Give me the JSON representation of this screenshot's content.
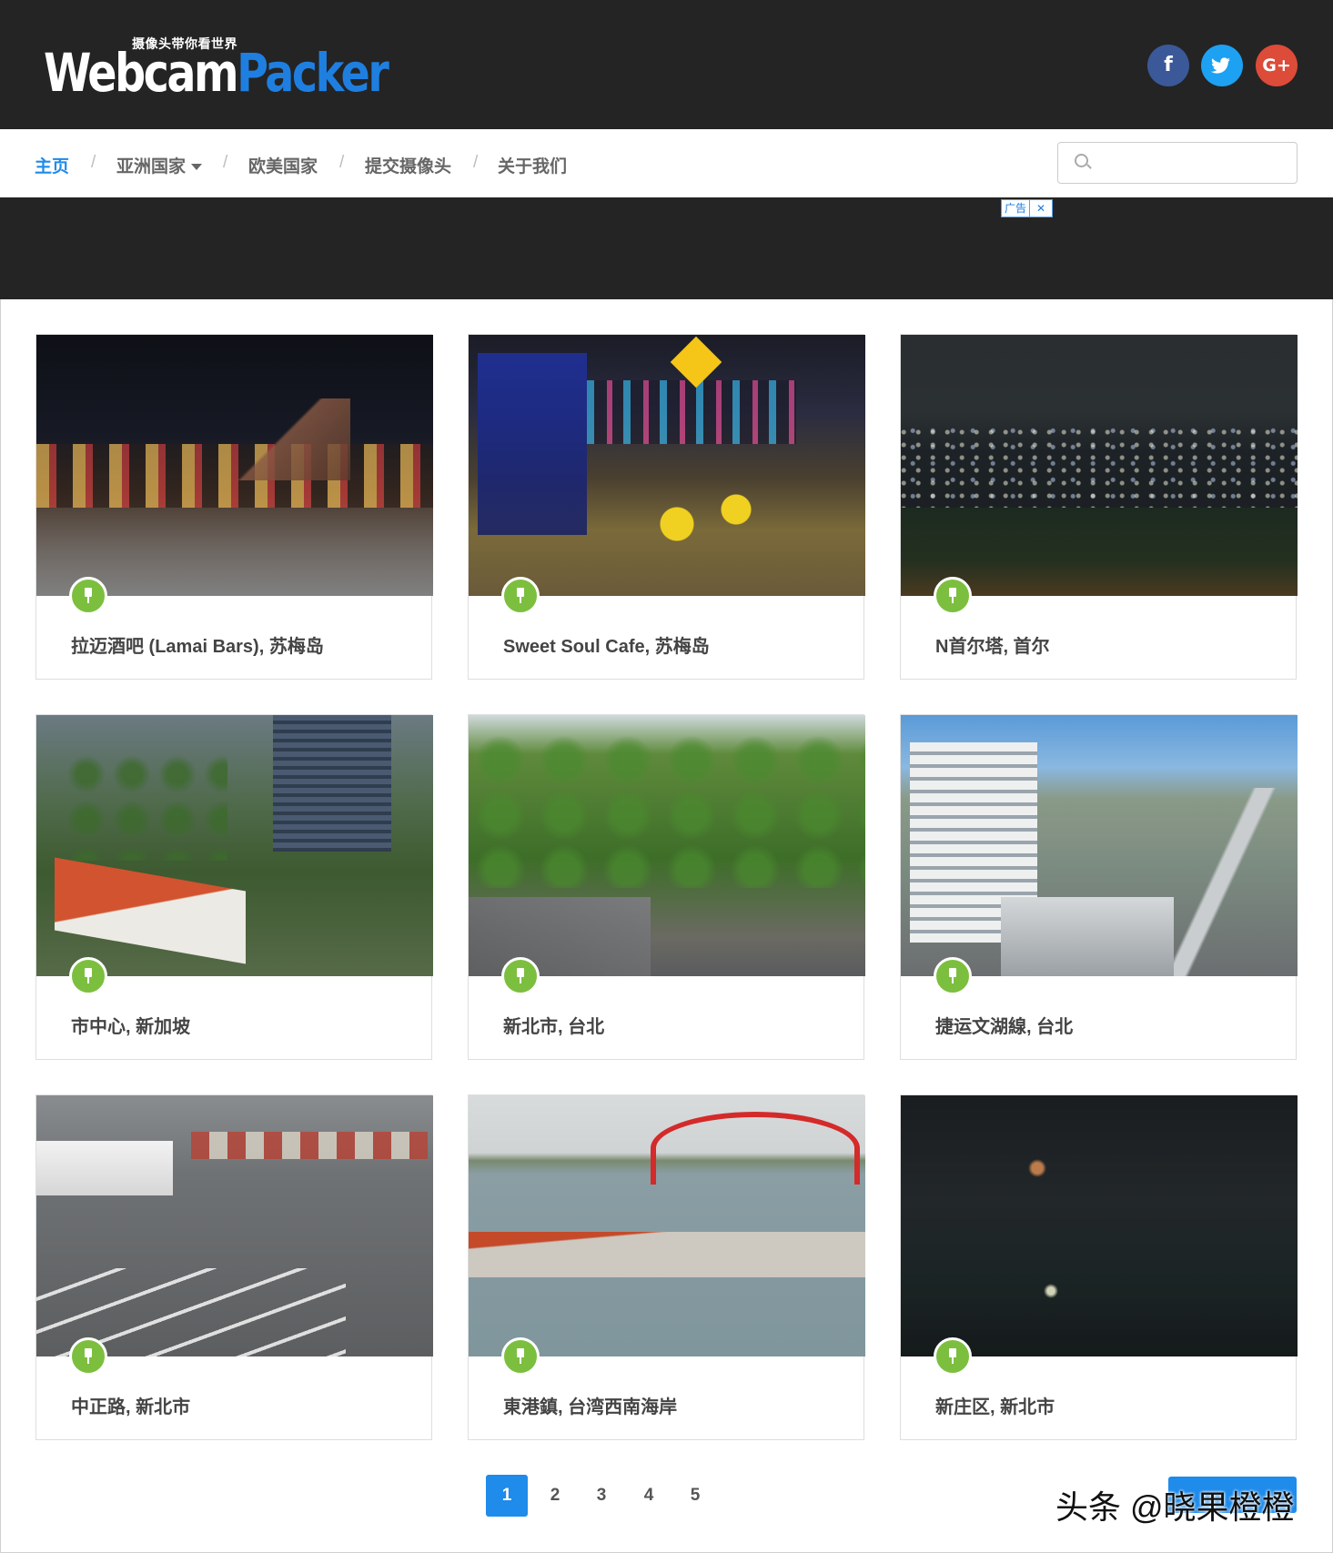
{
  "header": {
    "logo_tagline": "摄像头带你看世界",
    "logo_word_1": "Webcam",
    "logo_word_2": "Packer",
    "social": [
      {
        "name": "facebook-icon",
        "glyph": "f"
      },
      {
        "name": "twitter-icon",
        "glyph": "t"
      },
      {
        "name": "google-plus-icon",
        "glyph": "G+"
      }
    ]
  },
  "nav": {
    "items": [
      "主页",
      "亚洲国家",
      "欧美国家",
      "提交摄像头",
      "关于我们"
    ],
    "separator": "/",
    "search_placeholder": ""
  },
  "ad": {
    "badge_label": "广告",
    "close_glyph": "✕"
  },
  "cards": [
    {
      "title": "拉迈酒吧 (Lamai Bars), 苏梅岛",
      "scene": "night-street"
    },
    {
      "title": "Sweet Soul Cafe, 苏梅岛",
      "scene": "night-bar"
    },
    {
      "title": "N首尔塔, 首尔",
      "scene": "night-city"
    },
    {
      "title": "市中心, 新加坡",
      "scene": "day-city-green"
    },
    {
      "title": "新北市, 台北",
      "scene": "day-trees"
    },
    {
      "title": "捷运文湖線, 台北",
      "scene": "day-skyline"
    },
    {
      "title": "中正路, 新北市",
      "scene": "day-road"
    },
    {
      "title": "東港鎮, 台湾西南海岸",
      "scene": "day-harbor"
    },
    {
      "title": "新庄区, 新北市",
      "scene": "night-dark"
    }
  ],
  "pagination": {
    "pages": [
      "1",
      "2",
      "3",
      "4",
      "5"
    ],
    "current": "1"
  },
  "watermark": "头条 @晓果橙橙",
  "colors": {
    "accent": "#1f8bea",
    "pin": "#7cbf3f",
    "header_bg": "#242424"
  }
}
